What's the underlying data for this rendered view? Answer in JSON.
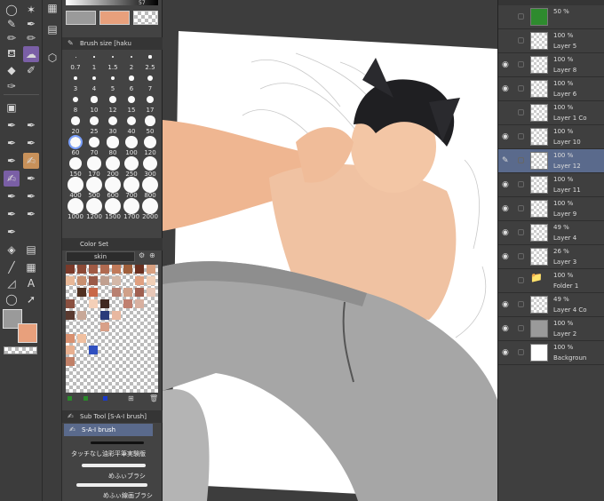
{
  "brush_panel": {
    "title": "Brush size [haku",
    "sizes": [
      "0.7",
      "1",
      "1.5",
      "2",
      "2.5",
      "3",
      "4",
      "5",
      "6",
      "7",
      "8",
      "10",
      "12",
      "15",
      "17",
      "20",
      "25",
      "30",
      "40",
      "50",
      "60",
      "70",
      "80",
      "100",
      "120",
      "150",
      "170",
      "200",
      "250",
      "300",
      "400",
      "500",
      "600",
      "700",
      "800",
      "1000",
      "1200",
      "1500",
      "1700",
      "2000"
    ]
  },
  "color_set": {
    "title": "Color Set",
    "selected_set": "skin"
  },
  "sub_tool": {
    "title": "Sub Tool [S-A-I brush]",
    "items": [
      "S-A-I brush",
      "タッチなし油彩平筆実験版",
      "めふぃブラシ",
      "めふぃ線画ブラシ"
    ]
  },
  "color_slider": {
    "value": "57"
  },
  "layers": [
    {
      "pct": "50 %",
      "name": "",
      "kind": "green"
    },
    {
      "pct": "100 %",
      "name": "Layer 5",
      "kind": "sketch"
    },
    {
      "pct": "100 %",
      "name": "Layer 8",
      "kind": "checker"
    },
    {
      "pct": "100 %",
      "name": "Layer 6",
      "kind": "checker"
    },
    {
      "pct": "100 %",
      "name": "Layer 1 Co",
      "kind": "checker"
    },
    {
      "pct": "100 %",
      "name": "Layer 10",
      "kind": "checker"
    },
    {
      "pct": "100 %",
      "name": "Layer 12",
      "kind": "sketch",
      "selected": true
    },
    {
      "pct": "100 %",
      "name": "Layer 11",
      "kind": "checker"
    },
    {
      "pct": "100 %",
      "name": "Layer 9",
      "kind": "checker"
    },
    {
      "pct": "49 %",
      "name": "Layer 4",
      "kind": "checker"
    },
    {
      "pct": "26 %",
      "name": "Layer 3",
      "kind": "checker"
    },
    {
      "pct": "100 %",
      "name": "Folder 1",
      "kind": "folder"
    },
    {
      "pct": "49 %",
      "name": "Layer 4 Co",
      "kind": "checker"
    },
    {
      "pct": "100 %",
      "name": "Layer 2",
      "kind": "gray"
    },
    {
      "pct": "100 %",
      "name": "Backgroun",
      "kind": "white"
    }
  ],
  "colors": {
    "main_color": "#9a9a9a",
    "sub_color": "#e8a07c",
    "layer_selected": "#5a6a8c",
    "skin": "#efc3a4"
  }
}
